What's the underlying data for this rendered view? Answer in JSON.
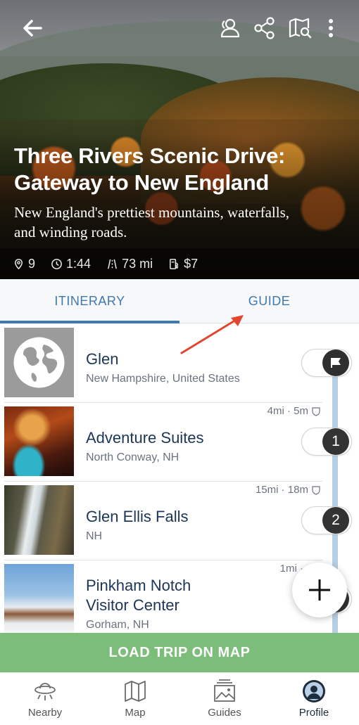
{
  "header": {
    "title_line1": "Three Rivers Scenic Drive:",
    "title_line2": "Gateway to New England",
    "subtitle_line1": "New England's prettiest mountains, waterfalls,",
    "subtitle_line2": "and winding roads.",
    "icons": [
      "back-arrow-icon",
      "collaborators-icon",
      "share-icon",
      "map-search-icon",
      "more-vertical-icon"
    ]
  },
  "stats": {
    "stops": "9",
    "duration": "1:44",
    "distance": "73 mi",
    "cost": "$7"
  },
  "tabs": [
    {
      "label": "ITINERARY",
      "active": true
    },
    {
      "label": "GUIDE",
      "active": false
    }
  ],
  "stops": [
    {
      "name": "Glen",
      "location": "New Hampshire, United States",
      "distance": "",
      "marker": "flag"
    },
    {
      "name": "Adventure Suites",
      "location": "North Conway, NH",
      "distance": "4mi · 5m",
      "marker": "1"
    },
    {
      "name": "Glen Ellis Falls",
      "location": "NH",
      "distance": "15mi · 18m",
      "marker": "2"
    },
    {
      "name_line1": "Pinkham Notch",
      "name_line2": "Visitor Center",
      "location": "Gorham, NH",
      "distance": "1mi · 1m",
      "marker": "3"
    }
  ],
  "actions": {
    "load_trip": "LOAD TRIP ON MAP"
  },
  "nav": [
    {
      "label": "Nearby",
      "icon": "ufo-icon"
    },
    {
      "label": "Map",
      "icon": "map-icon"
    },
    {
      "label": "Guides",
      "icon": "guides-icon"
    },
    {
      "label": "Profile",
      "icon": "profile-icon",
      "active": true
    }
  ],
  "colors": {
    "accent": "#3f79ad",
    "load_button": "#7dbd7a",
    "title_text": "#1d3557",
    "timeline": "#b7cfe3"
  }
}
